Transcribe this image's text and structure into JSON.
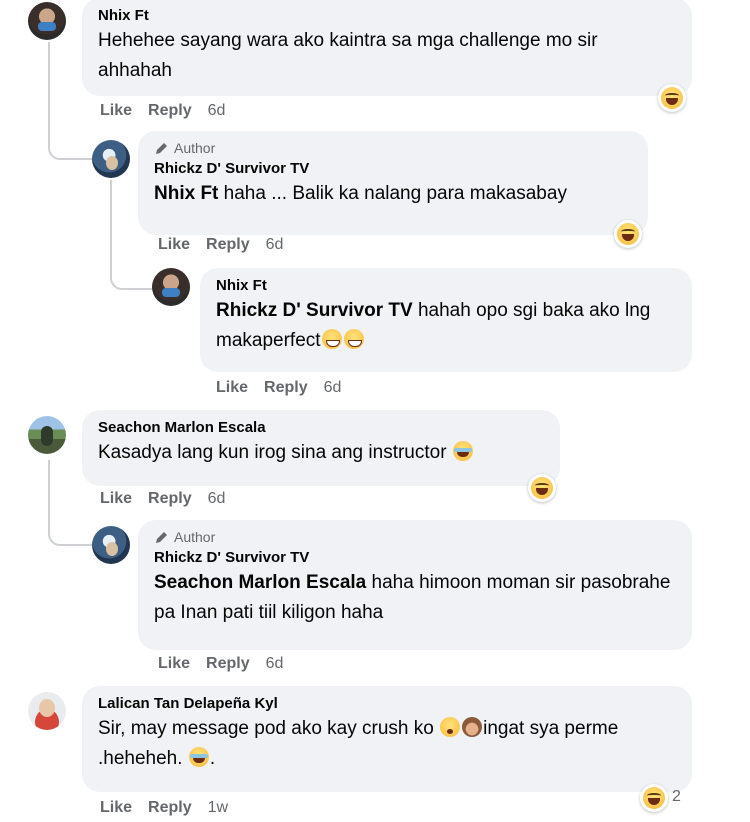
{
  "reply_actions": {
    "like": "Like",
    "reply": "Reply"
  },
  "author_badge": "Author",
  "comments": [
    {
      "name": "Nhix Ft",
      "text": "Hehehee sayang wara ako kaintra sa mga challenge mo sir ahhahah",
      "time": "6d"
    },
    {
      "name": "Rhickz D' Survivor TV",
      "mention": "Nhix Ft",
      "text": "haha ... Balik ka nalang para makasabay",
      "time": "6d"
    },
    {
      "name": "Nhix Ft",
      "mention": "Rhickz D' Survivor TV",
      "text": "hahah opo sgi baka ako lng makaperfect",
      "time": "6d"
    },
    {
      "name": "Seachon Marlon Escala",
      "text": "Kasadya lang kun irog sina ang instructor",
      "time": "6d"
    },
    {
      "name": "Rhickz D' Survivor TV",
      "mention": "Seachon Marlon Escala",
      "text": "haha himoon moman sir pasobrahe pa Inan pati tiil kiligon haha",
      "time": "6d"
    },
    {
      "name": "Lalican Tan Delapeña Kyl",
      "text_a": "Sir, may message pod ako kay crush ko",
      "text_b": "ingat sya perme .heheheh.",
      "time": "1w",
      "reaction_count": "2"
    }
  ]
}
